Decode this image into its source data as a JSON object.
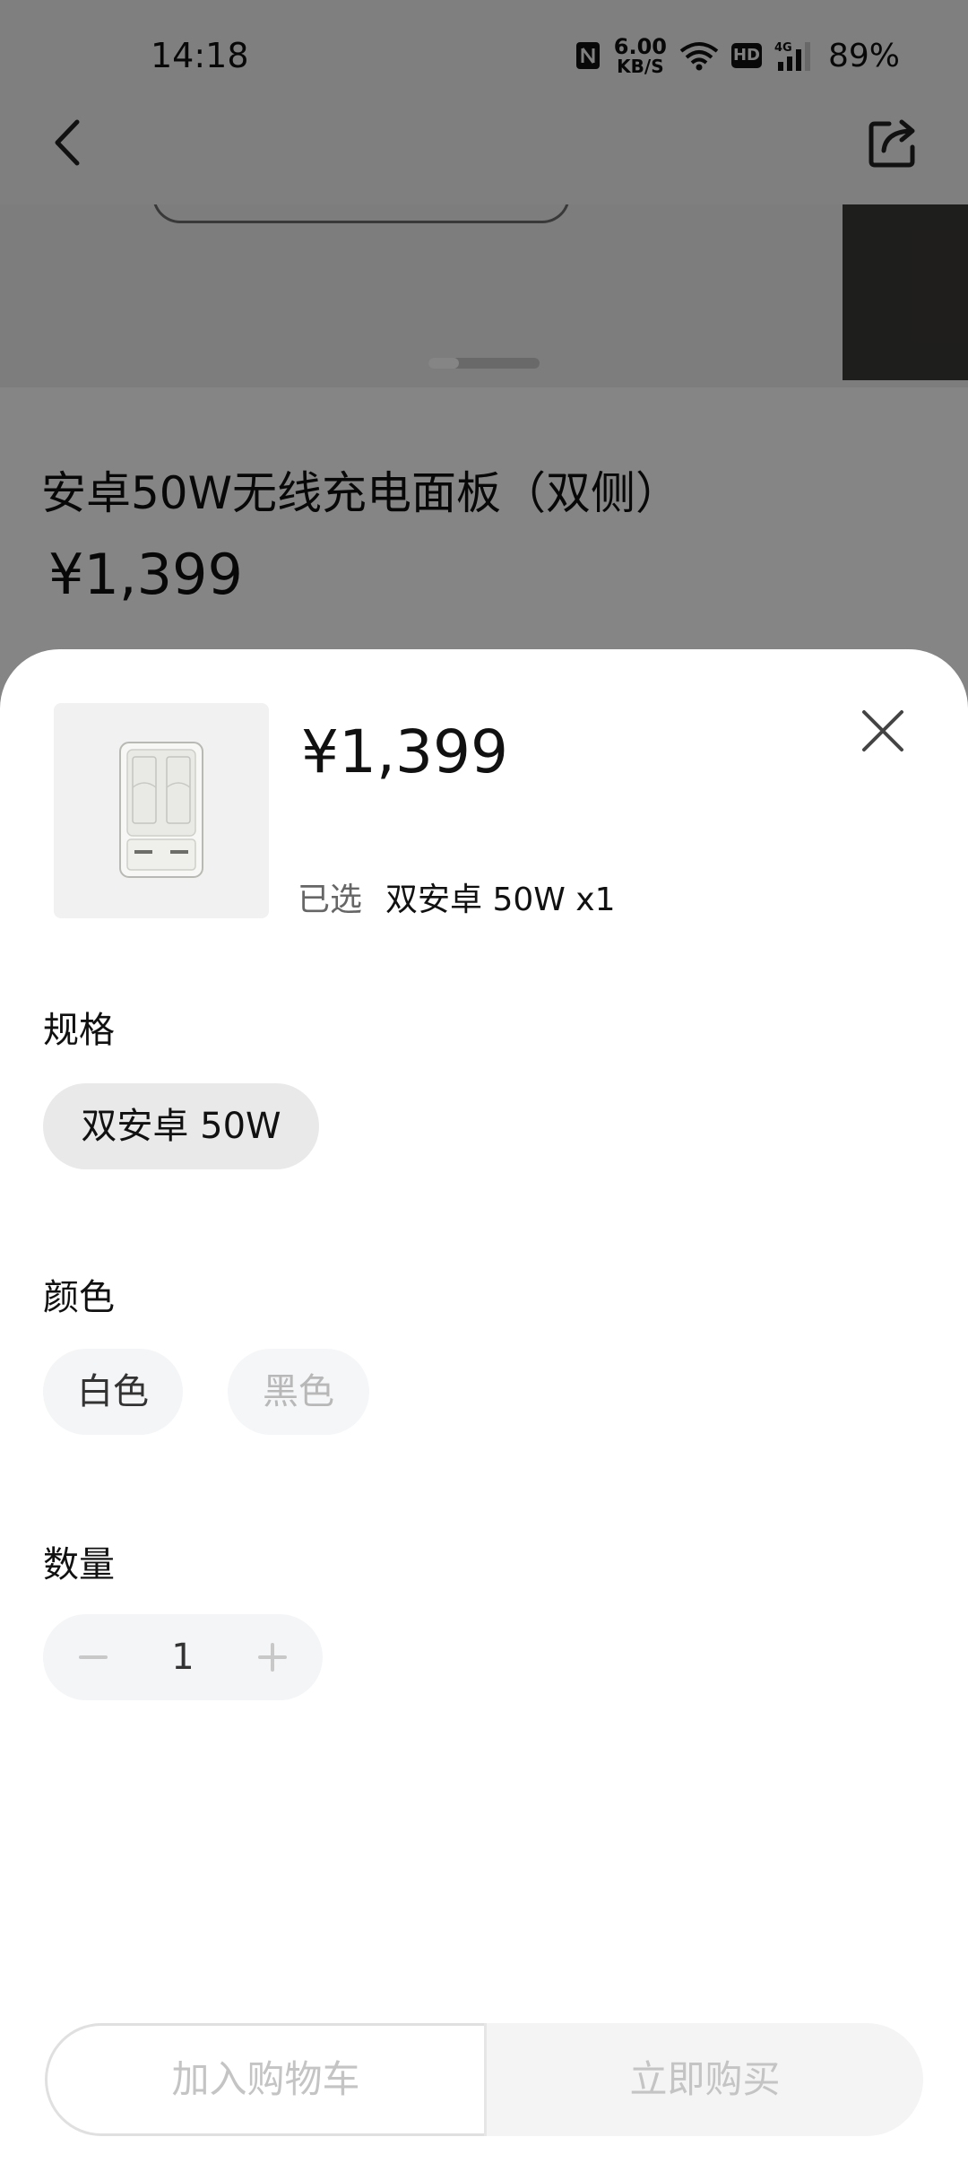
{
  "status_bar": {
    "time": "14:18",
    "net_speed_value": "6.00",
    "net_speed_unit": "KB/S",
    "hd_label": "HD",
    "network": "4G",
    "battery": "89%"
  },
  "product": {
    "title": "安卓50W无线充电面板（双侧）",
    "price": "¥1,399"
  },
  "sheet": {
    "price": "¥1,399",
    "selected_label": "已选",
    "selected_value": "双安卓 50W x1",
    "spec_label": "规格",
    "spec_options": [
      "双安卓 50W"
    ],
    "color_label": "颜色",
    "color_options": [
      "白色",
      "黑色"
    ],
    "quantity_label": "数量",
    "quantity": "1",
    "add_to_cart": "加入购物车",
    "buy_now": "立即购买"
  }
}
